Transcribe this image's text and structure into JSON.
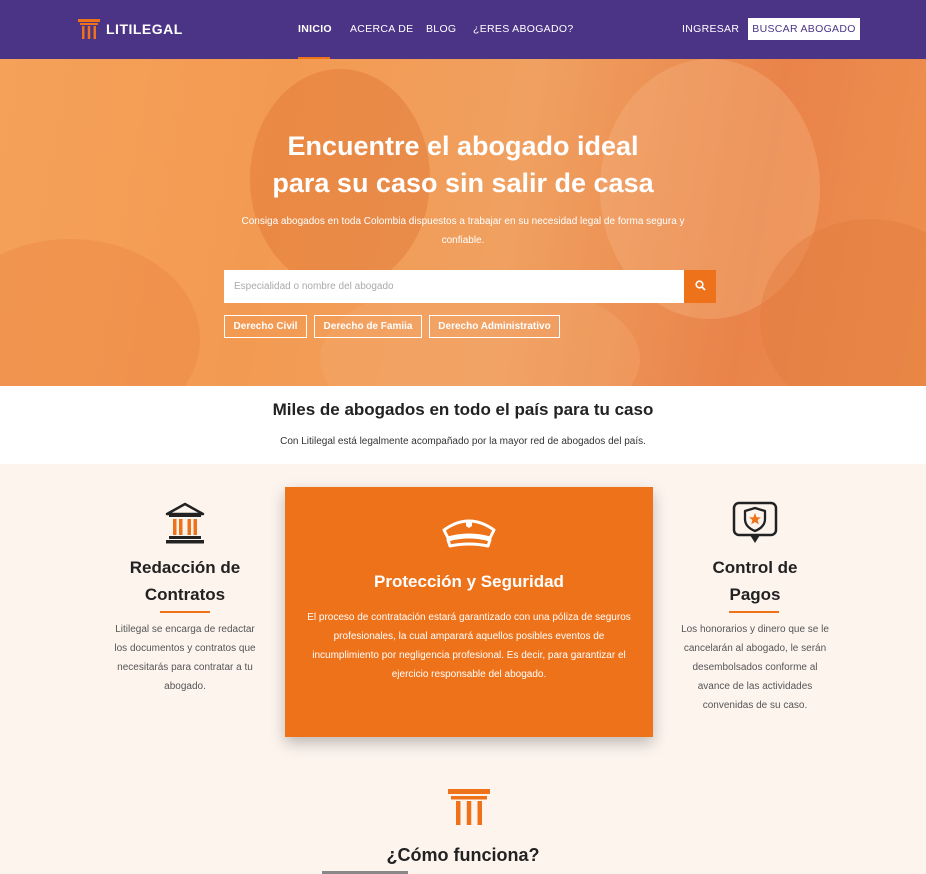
{
  "brand": {
    "name": "LITILEGAL"
  },
  "nav": {
    "links": [
      "INICIO",
      "ACERCA DE",
      "BLOG",
      "¿ERES ABOGADO?"
    ],
    "login": "INGRESAR",
    "cta": "BUSCAR ABOGADO"
  },
  "hero": {
    "title_line1": "Encuentre el abogado ideal",
    "title_line2": "para su caso sin salir de casa",
    "subtitle": "Consiga abogados en toda Colombia dispuestos a trabajar en su necesidad legal de forma segura y confiable.",
    "search_placeholder": "Especialidad o nombre del abogado",
    "chips": [
      "Derecho Civil",
      "Derecho de Famiia",
      "Derecho Administrativo"
    ]
  },
  "miles": {
    "title": "Miles de abogados en todo el país para tu caso",
    "subtitle": "Con Litilegal está legalmente acompañado por la mayor red de abogados del país."
  },
  "features": [
    {
      "icon": "courthouse-icon",
      "title_line1": "Redacción de",
      "title_line2": "Contratos",
      "description": "Litilegal se encarga de redactar los documentos y contratos que necesitarás para contratar a tu abogado."
    },
    {
      "icon": "police-cap-icon",
      "title": "Protección y Seguridad",
      "description": "El proceso de contratación estará garantizado con una póliza de seguros profesionales, la cual amparará aquellos posibles eventos de incumplimiento por negligencia profesional. Es decir, para garantizar el ejercicio responsable del abogado."
    },
    {
      "icon": "shield-star-badge-icon",
      "title_line1": "Control de",
      "title_line2": "Pagos",
      "description": "Los honorarios y dinero que se le cancelarán al abogado, le serán desembolsados conforme al avance de las actividades convenidas de su caso."
    }
  ],
  "como": {
    "title": "¿Cómo funciona?"
  },
  "colors": {
    "purple": "#4b3486",
    "orange": "#ee7219",
    "cream": "#fdf4ee"
  }
}
